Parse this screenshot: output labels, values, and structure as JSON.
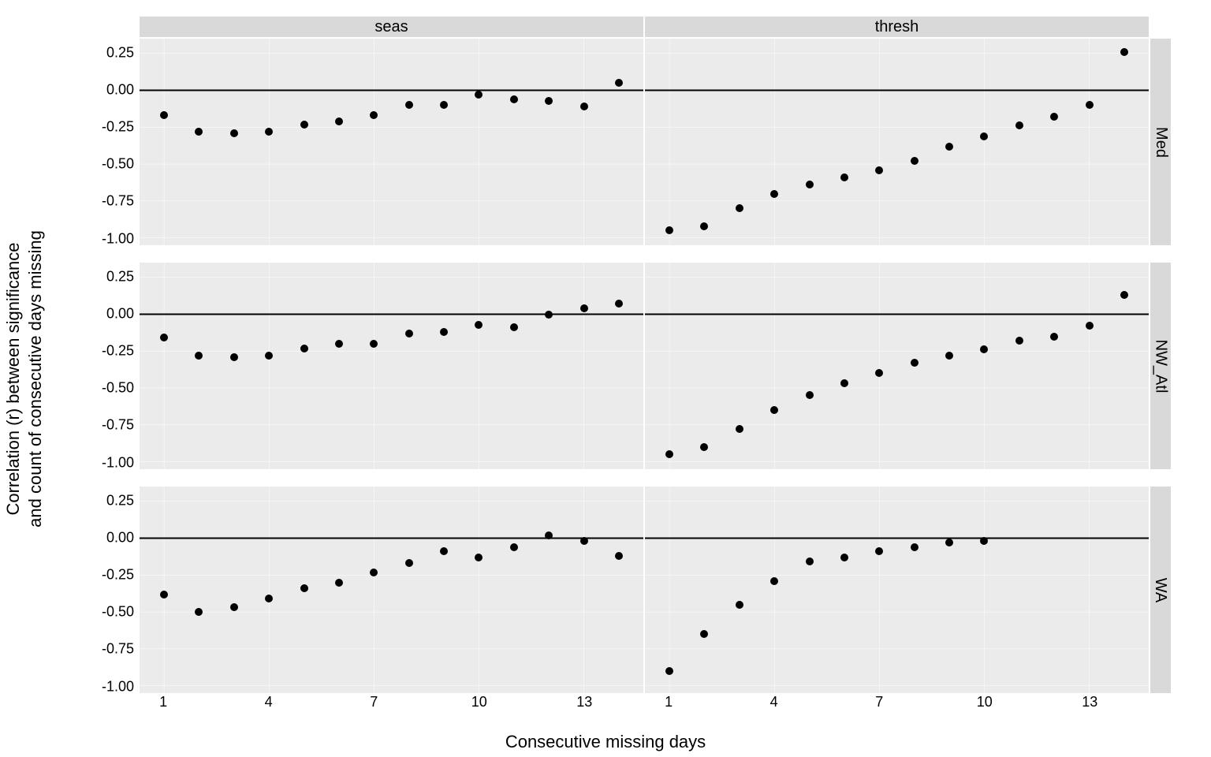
{
  "xlabel": "Consecutive missing days",
  "ylabel_line1": "Correlation (r) between significance",
  "ylabel_line2": "and count of consecutive days missing",
  "col_strips": [
    "seas",
    "thresh"
  ],
  "row_strips": [
    "Med",
    "NW_Atl",
    "WA"
  ],
  "x_ticks": [
    1,
    4,
    7,
    10,
    13
  ],
  "y_ticks": [
    -1.0,
    -0.75,
    -0.5,
    -0.25,
    0.0,
    0.25
  ],
  "ylim": [
    -1.05,
    0.35
  ],
  "xlim": [
    0.3,
    14.7
  ],
  "chart_data": {
    "type": "scatter",
    "grid": {
      "columns": [
        "seas",
        "thresh"
      ],
      "rows": [
        "Med",
        "NW_Atl",
        "WA"
      ]
    },
    "x_common": [
      1,
      2,
      3,
      4,
      5,
      6,
      7,
      8,
      9,
      10,
      11,
      12,
      13,
      14
    ],
    "hline": 0,
    "xlabel": "Consecutive missing days",
    "ylabel": "Correlation (r) between significance and count of consecutive days missing",
    "ylim": [
      -1.05,
      0.35
    ],
    "xlim": [
      0.3,
      14.7
    ],
    "y_ticks": [
      -1.0,
      -0.75,
      -0.5,
      -0.25,
      0.0,
      0.25
    ],
    "x_ticks": [
      1,
      4,
      7,
      10,
      13
    ],
    "series": [
      {
        "row": "Med",
        "col": "seas",
        "y": [
          -0.17,
          -0.28,
          -0.29,
          -0.28,
          -0.23,
          -0.21,
          -0.17,
          -0.1,
          -0.1,
          -0.03,
          -0.06,
          -0.07,
          -0.11,
          0.05
        ],
        "x_max_plot": 14
      },
      {
        "row": "Med",
        "col": "thresh",
        "y": [
          -0.95,
          -0.92,
          -0.8,
          -0.7,
          -0.64,
          -0.59,
          -0.54,
          -0.48,
          -0.38,
          -0.31,
          -0.24,
          -0.18,
          -0.1,
          0.26
        ],
        "x_max_plot": 14
      },
      {
        "row": "NW_Atl",
        "col": "seas",
        "y": [
          -0.16,
          -0.28,
          -0.29,
          -0.28,
          -0.23,
          -0.2,
          -0.2,
          -0.13,
          -0.12,
          -0.07,
          -0.09,
          0.0,
          0.04,
          0.07
        ],
        "x_max_plot": 14
      },
      {
        "row": "NW_Atl",
        "col": "thresh",
        "y": [
          -0.95,
          -0.9,
          -0.78,
          -0.65,
          -0.55,
          -0.47,
          -0.4,
          -0.33,
          -0.28,
          -0.24,
          -0.18,
          -0.15,
          -0.08,
          0.13
        ],
        "x_max_plot": 14
      },
      {
        "row": "WA",
        "col": "seas",
        "y": [
          -0.38,
          -0.5,
          -0.47,
          -0.41,
          -0.34,
          -0.3,
          -0.23,
          -0.17,
          -0.09,
          -0.13,
          -0.06,
          0.02,
          -0.02,
          -0.12
        ],
        "x_max_plot": 14
      },
      {
        "row": "WA",
        "col": "thresh",
        "y": [
          -0.9,
          -0.65,
          -0.45,
          -0.29,
          -0.16,
          -0.13,
          -0.09,
          -0.06,
          -0.03,
          -0.02
        ],
        "x_max_plot": 10
      }
    ]
  }
}
